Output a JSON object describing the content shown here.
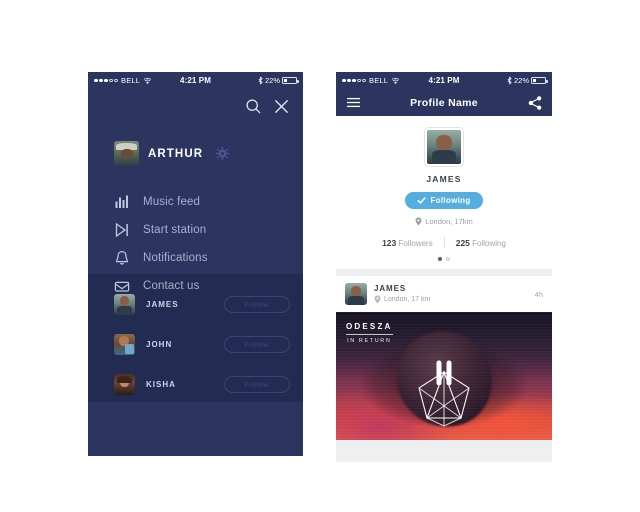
{
  "colors": {
    "navy": "#2c3560",
    "navy_dark": "#222b52",
    "accent_blue": "#55aee0",
    "page_bg": "#ffffff",
    "card_bg": "#ffffff",
    "gutter_gray": "#eeeff1",
    "menu_label": "#a9b0cd"
  },
  "status_bar": {
    "signal_dots_filled": 3,
    "signal_dots_empty": 2,
    "carrier": "BELL",
    "wifi_icon": "wifi-icon",
    "time": "4:21 PM",
    "bluetooth_icon": "bluetooth-icon",
    "battery_percent": "22%",
    "battery_icon": "battery-icon"
  },
  "drawer": {
    "search_icon": "search-icon",
    "close_icon": "close-icon",
    "user": {
      "name": "ARTHUR",
      "avatar": "avatar-arthur",
      "settings_icon": "gear-icon"
    },
    "menu": [
      {
        "label": "Music feed",
        "icon": "equalizer-icon"
      },
      {
        "label": "Start station",
        "icon": "skip-next-icon"
      },
      {
        "label": "Notifications",
        "icon": "bell-icon"
      },
      {
        "label": "Contact us",
        "icon": "envelope-icon"
      }
    ],
    "friends": [
      {
        "name": "JAMES",
        "avatar": "avatar-james",
        "action_label": "Follow"
      },
      {
        "name": "JOHN",
        "avatar": "avatar-john",
        "action_label": "Follow"
      },
      {
        "name": "KISHA",
        "avatar": "avatar-kisha",
        "action_label": "Follow"
      }
    ]
  },
  "profile_screen": {
    "navbar": {
      "menu_icon": "hamburger-icon",
      "title": "Profile Name",
      "share_icon": "share-icon"
    },
    "profile": {
      "avatar": "avatar-james",
      "name": "JAMES",
      "follow_state_label": "Following",
      "follow_state_icon": "check-icon",
      "location_icon": "map-pin-icon",
      "location": "London, 17km",
      "stats": [
        {
          "value": "123",
          "label": "Followers"
        },
        {
          "value": "225",
          "label": "Following"
        }
      ],
      "pagination": {
        "total": 2,
        "active_index": 0
      }
    },
    "post": {
      "avatar": "avatar-james",
      "author": "JAMES",
      "location_icon": "map-pin-icon",
      "location": "London, 17 km",
      "timestamp": "4h",
      "artwork": {
        "album_artist": "ODESZA",
        "album_title": "IN RETURN",
        "playback_icon": "pause-icon",
        "logo_icon": "icosahedron-icon"
      }
    }
  }
}
